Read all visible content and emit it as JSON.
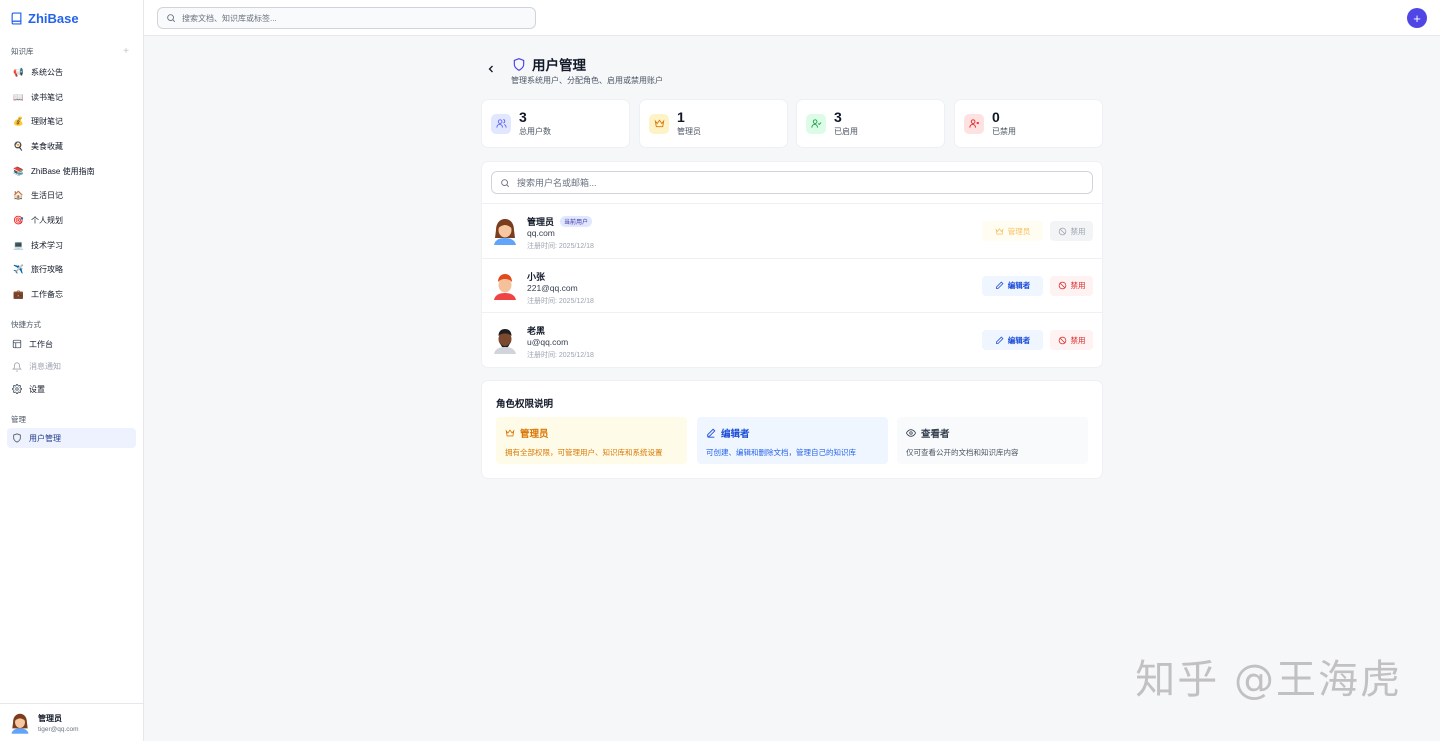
{
  "app": {
    "name": "ZhiBase"
  },
  "sidebar": {
    "kb_section": "知识库",
    "kb_items": [
      {
        "emoji": "📢",
        "label": "系统公告"
      },
      {
        "emoji": "📖",
        "label": "读书笔记"
      },
      {
        "emoji": "💰",
        "label": "理财笔记"
      },
      {
        "emoji": "🍳",
        "label": "美食收藏"
      },
      {
        "emoji": "📚",
        "label": "ZhiBase 使用指南"
      },
      {
        "emoji": "🏠",
        "label": "生活日记"
      },
      {
        "emoji": "🎯",
        "label": "个人规划"
      },
      {
        "emoji": "💻",
        "label": "技术学习"
      },
      {
        "emoji": "✈️",
        "label": "旅行攻略"
      },
      {
        "emoji": "💼",
        "label": "工作备忘"
      }
    ],
    "shortcut_section": "快捷方式",
    "shortcuts": [
      {
        "label": "工作台"
      },
      {
        "label": "消息通知"
      },
      {
        "label": "设置"
      }
    ],
    "admin_section": "管理",
    "admin_items": [
      {
        "label": "用户管理"
      }
    ],
    "footer": {
      "name": "管理员",
      "email": "tiger@qq.com"
    }
  },
  "topbar": {
    "search_placeholder": "搜索文档、知识库或标签..."
  },
  "page": {
    "title": "用户管理",
    "subtitle": "管理系统用户、分配角色、启用或禁用账户"
  },
  "stats": [
    {
      "value": "3",
      "label": "总用户数",
      "color": "#6366f1",
      "bg": "#e0e7ff"
    },
    {
      "value": "1",
      "label": "管理员",
      "color": "#d97706",
      "bg": "#fef3c7"
    },
    {
      "value": "3",
      "label": "已启用",
      "color": "#16a34a",
      "bg": "#dcfce7"
    },
    {
      "value": "0",
      "label": "已禁用",
      "color": "#dc2626",
      "bg": "#fee2e2"
    }
  ],
  "user_search_placeholder": "搜索用户名或邮箱...",
  "users": [
    {
      "name": "管理员",
      "badge": "当前用户",
      "email": "qq.com",
      "date": "注册时间: 2025/12/18",
      "role": "管理员",
      "ban": "禁用"
    },
    {
      "name": "小张",
      "email": "221@qq.com",
      "date": "注册时间: 2025/12/18",
      "role": "编辑者",
      "ban": "禁用"
    },
    {
      "name": "老黑",
      "email": "u@qq.com",
      "date": "注册时间: 2025/12/18",
      "role": "编辑者",
      "ban": "禁用"
    }
  ],
  "roles": {
    "title": "角色权限说明",
    "items": [
      {
        "name": "管理员",
        "desc": "拥有全部权限，可管理用户、知识库和系统设置"
      },
      {
        "name": "编辑者",
        "desc": "可创建、编辑和删除文档，管理自己的知识库"
      },
      {
        "name": "查看者",
        "desc": "仅可查看公开的文档和知识库内容"
      }
    ]
  },
  "watermark": "知乎 @王海虎"
}
